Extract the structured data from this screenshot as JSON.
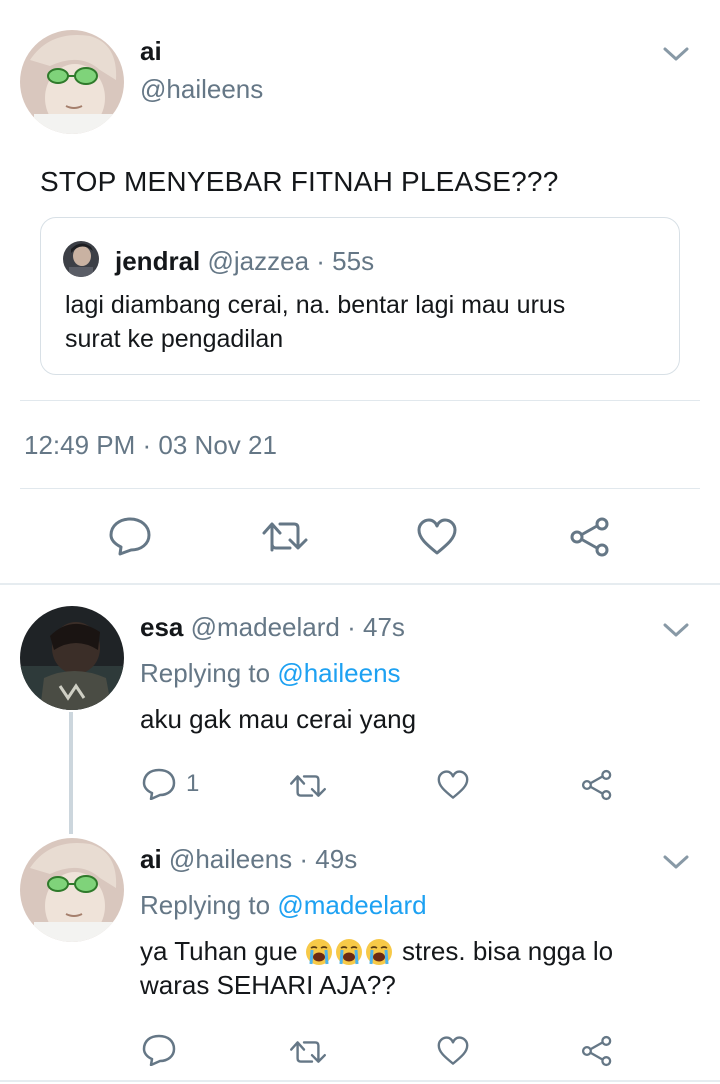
{
  "main_tweet": {
    "name": "ai",
    "handle": "@haileens",
    "text": "STOP MENYEBAR FITNAH PLEASE???",
    "timestamp": "12:49 PM · 03 Nov 21",
    "avatar_icon": "profile-photo",
    "quoted": {
      "name": "jendral",
      "handle": "@jazzea",
      "time": "· 55s",
      "text_line1": "lagi diambang cerai, na. bentar lagi mau urus",
      "text_line2": "surat ke pengadilan"
    },
    "actions": [
      "reply-icon",
      "retweet-icon",
      "like-icon",
      "share-icon"
    ]
  },
  "replies": [
    {
      "name": "esa",
      "handle": "@madeelard",
      "time": "· 47s",
      "replying_prefix": "Replying to",
      "replying_to": "@haileens",
      "text": "aku gak mau cerai yang",
      "reply_count": "1"
    },
    {
      "name": "ai",
      "handle": "@haileens",
      "time": "· 49s",
      "replying_prefix": "Replying to",
      "replying_to": "@madeelard",
      "text_pre": "ya Tuhan gue",
      "emoji": "loudly-crying-face",
      "text_post": "stres. bisa ngga lo",
      "text_line2": "waras SEHARI AJA??"
    }
  ],
  "colors": {
    "link": "#1da1f2",
    "secondary_text": "#657786",
    "primary_text": "#14171a",
    "divider": "#e1e8ed"
  }
}
